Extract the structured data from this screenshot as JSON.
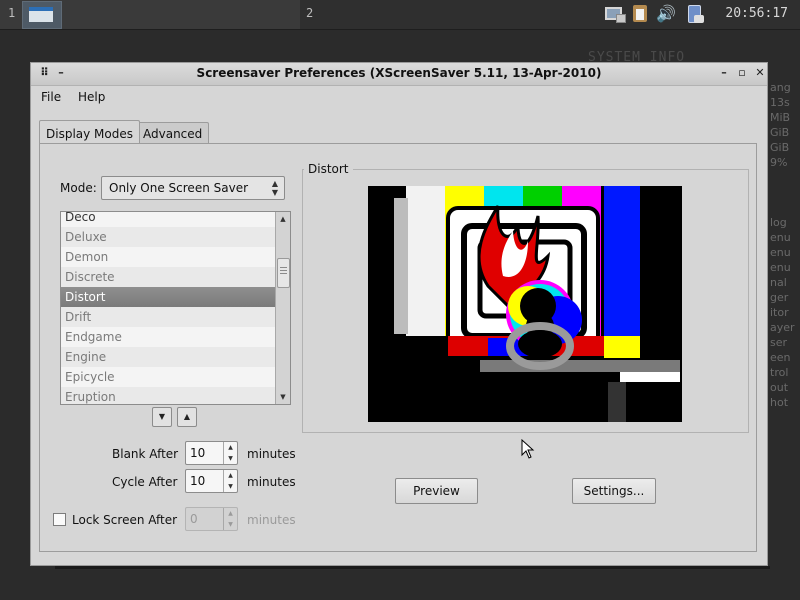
{
  "panel": {
    "workspace_1": "1",
    "workspace_2": "2",
    "clock": "20:56:17",
    "tray_icons": [
      "network-icon",
      "clipboard-icon",
      "volume-icon",
      "power-icon"
    ]
  },
  "desktop": {
    "conky_title": "SYSTEM INFO",
    "conky_right_lines": [
      "ang",
      "13s",
      "MiB",
      "GiB",
      "GiB",
      "9%",
      "",
      "",
      "",
      "log",
      "enu",
      "enu",
      "enu",
      "nal",
      "ger",
      "itor",
      "ayer",
      "ser",
      "een",
      "trol",
      "out",
      "hot"
    ]
  },
  "window": {
    "title": "Screensaver Preferences  (XScreenSaver 5.11, 13-Apr-2010)",
    "menu": {
      "file": "File",
      "help": "Help"
    },
    "tabs": {
      "display_modes": "Display Modes",
      "advanced": "Advanced"
    },
    "mode": {
      "label": "Mode:",
      "value": "Only One Screen Saver"
    },
    "saver_list": [
      "Deco",
      "Deluxe",
      "Demon",
      "Discrete",
      "Distort",
      "Drift",
      "Endgame",
      "Engine",
      "Epicycle",
      "Eruption"
    ],
    "selected_saver": "Distort",
    "blank_after": {
      "label": "Blank After",
      "value": "10",
      "unit": "minutes"
    },
    "cycle_after": {
      "label": "Cycle After",
      "value": "10",
      "unit": "minutes"
    },
    "lock_screen": {
      "label": "Lock Screen After",
      "value": "0",
      "unit": "minutes",
      "checked": false
    },
    "preview_frame_label": "Distort",
    "buttons": {
      "preview": "Preview",
      "settings": "Settings..."
    }
  },
  "colors": {
    "selection": "#7f7f7f",
    "window_bg": "#d6d6d6",
    "desktop_bg": "#2b2b2b"
  }
}
